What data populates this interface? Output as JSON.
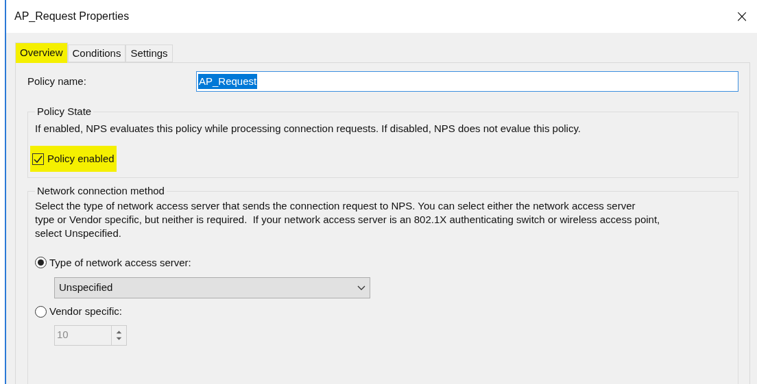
{
  "window": {
    "title": "AP_Request Properties",
    "close": "×"
  },
  "tabs": [
    {
      "label": "Overview",
      "selected": true,
      "highlighted": true
    },
    {
      "label": "Conditions",
      "selected": false,
      "highlighted": false
    },
    {
      "label": "Settings",
      "selected": false,
      "highlighted": false
    }
  ],
  "policy_name": {
    "label": "Policy name:",
    "value": "AP_Request"
  },
  "policy_state": {
    "title": "Policy State",
    "description": "If enabled, NPS evaluates this policy while processing connection requests. If disabled, NPS does not evalue this policy.",
    "checkbox": {
      "label": "Policy enabled",
      "checked": true,
      "highlighted": true
    }
  },
  "network_connection_method": {
    "title": "Network connection method",
    "description_lines": [
      "Select the type of network access server that sends the connection request to NPS. You can select either the network access server",
      "type or Vendor specific, but neither is required.  If your network access server is an 802.1X authenticating switch or wireless access point,",
      "select Unspecified."
    ],
    "options": [
      {
        "label": "Type of network access server:",
        "selected": true
      },
      {
        "label": "Vendor specific:",
        "selected": false
      }
    ],
    "server_type": {
      "value": "Unspecified"
    },
    "vendor_code": {
      "value": "10",
      "disabled": true
    }
  }
}
